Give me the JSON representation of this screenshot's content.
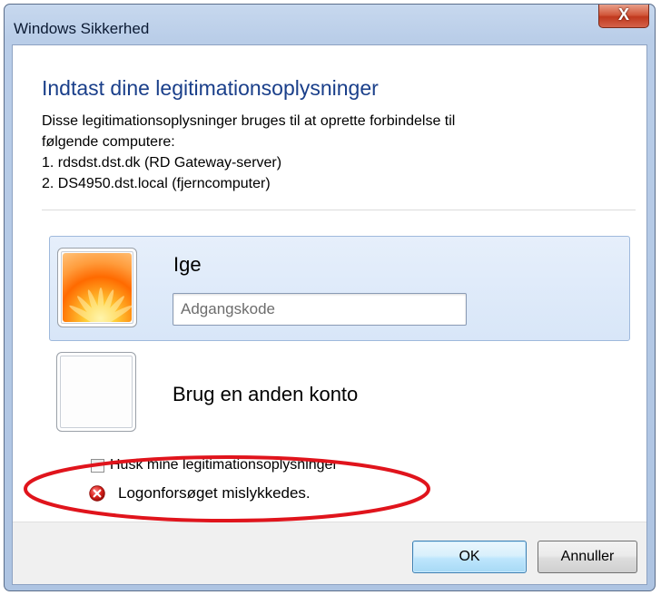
{
  "window": {
    "title": "Windows Sikkerhed",
    "close_symbol": "X"
  },
  "header": {
    "heading": "Indtast dine legitimationsoplysninger",
    "description_lines": [
      "Disse legitimationsoplysninger bruges til at oprette forbindelse til",
      "følgende computere:",
      "1. rdsdst.dst.dk (RD Gateway-server)",
      "2. DS4950.dst.local (fjerncomputer)"
    ]
  },
  "accounts": {
    "selected": {
      "name": "Ige",
      "picture_icon": "flower-avatar",
      "password_value": "",
      "password_placeholder": "Adgangskode"
    },
    "other": {
      "name": "Brug en anden konto",
      "picture_icon": "blank-avatar"
    }
  },
  "options": {
    "remember_label": "Husk mine legitimationsoplysninger",
    "remember_checked": false
  },
  "status": {
    "error_text": "Logonforsøget mislykkedes.",
    "error_icon": "error-x-icon"
  },
  "buttons": {
    "ok": "OK",
    "cancel": "Annuller"
  },
  "colors": {
    "heading": "#1a3f8a",
    "annotation": "#e0141c",
    "close_button": "#c0391e",
    "selected_tile": "#dce8f8"
  }
}
